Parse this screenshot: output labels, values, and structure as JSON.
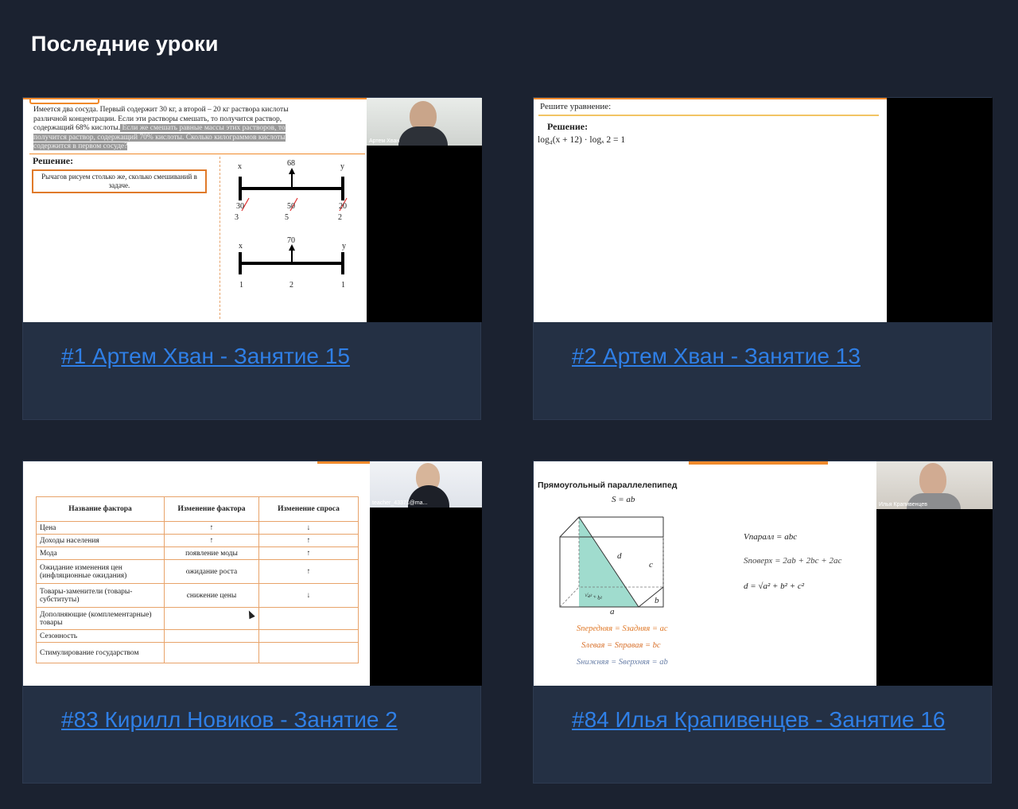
{
  "page": {
    "title": "Последние уроки"
  },
  "cards": [
    {
      "link": "#1 Артем Хван - Занятие 15",
      "cam_label": "Артем Хван",
      "slide": {
        "problem_1": "Имеется два сосуда. Первый содержит 30 кг, а второй – 20 кг раствора кислоты",
        "problem_2": "различной концентрации. Если эти растворы смешать, то получится раствор,",
        "problem_3": "содержащий 68% кислоты.",
        "problem_3b": " Если же смешать равные массы этих растворов, то",
        "problem_4": "получится раствор, содержащий 70% кислоты. Сколько килограммов кислоты",
        "problem_5": "содержится в первом сосуде?",
        "solution": "Решение:",
        "hint": "Рычагов рисуем столько же, сколько смешиваний в задаче.",
        "lever1": {
          "x": "x",
          "mid": "68",
          "y": "y",
          "a": "30",
          "b": "50",
          "c": "20",
          "a2": "3",
          "b2": "5",
          "c2": "2"
        },
        "lever2": {
          "x": "x",
          "mid": "70",
          "y": "y",
          "a": "1",
          "b": "2",
          "c": "1"
        }
      }
    },
    {
      "link": "#2 Артем Хван - Занятие 13",
      "slide": {
        "task": "Решите уравнение:",
        "solution": "Решение:",
        "equation": "log₄(x + 12) · logₓ 2 = 1"
      }
    },
    {
      "link": "#83 Кирилл Новиков - Занятие 2",
      "cam_label": "teacher_43371@ma...",
      "slide": {
        "headers": [
          "Название фактора",
          "Изменение фактора",
          "Изменение спроса"
        ],
        "rows": [
          [
            "Цена",
            "↑",
            "↓"
          ],
          [
            "Доходы населения",
            "↑",
            "↑"
          ],
          [
            "Мода",
            "появление моды",
            "↑"
          ],
          [
            "Ожидание изменения цен (инфляционные ожидания)",
            "ожидание роста",
            "↑"
          ],
          [
            "Товары-заменители (товары-субституты)",
            "снижение цены",
            "↓"
          ],
          [
            "Дополняющие (комплементарные) товары",
            "",
            ""
          ],
          [
            "Сезонность",
            "",
            ""
          ],
          [
            "Стимулирование государством",
            "",
            ""
          ]
        ]
      }
    },
    {
      "link": "#84 Илья Крапивенцев - Занятие 16",
      "cam_label": "Илья Крапивенцев",
      "slide": {
        "title": "Прямоугольный параллелепипед",
        "s_formula": "S = ab",
        "d": "d",
        "c": "c",
        "b": "b",
        "a": "a",
        "diag": "√a² + b²",
        "v": "Vпаралл = abc",
        "s_total": "Sповерх = 2ab + 2bc + 2ac",
        "d_formula": "d = √a² + b² + c²",
        "f1": "Sпередняя = Sзадняя = ac",
        "f2": "Sлевая = Sправая = bc",
        "f3": "Sнижняя = Sверхняя = ab"
      }
    }
  ]
}
